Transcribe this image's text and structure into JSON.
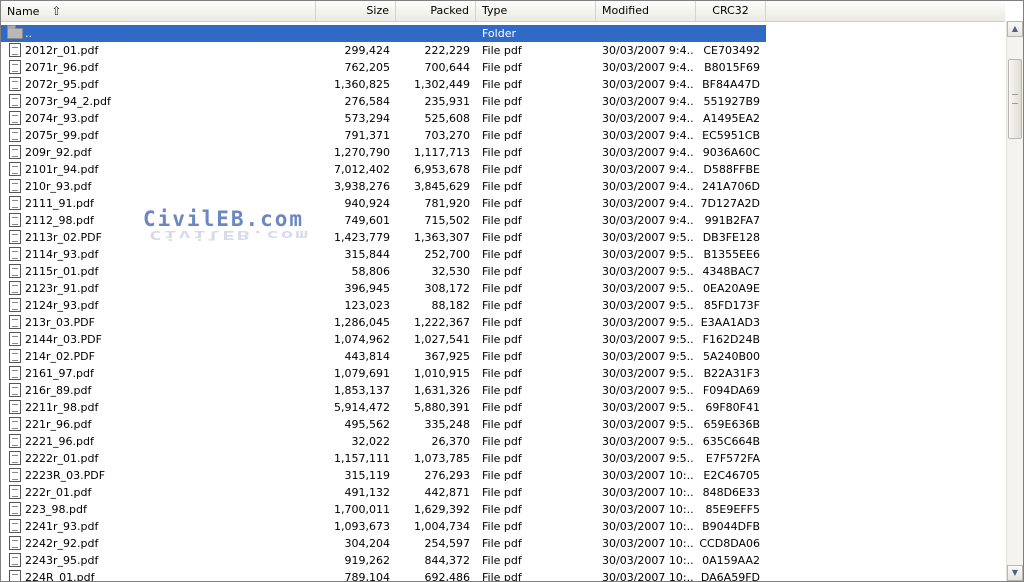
{
  "columns": {
    "name": "Name",
    "size": "Size",
    "packed": "Packed",
    "type": "Type",
    "modified": "Modified",
    "crc": "CRC32"
  },
  "sort_icon": "sort-up-arrow-icon",
  "watermark": "CivilEB.com",
  "parent_row": {
    "name": "..",
    "type": "Folder"
  },
  "files": [
    {
      "name": "2012r_01.pdf",
      "size": "299,424",
      "packed": "222,229",
      "type": "File pdf",
      "modified": "30/03/2007 9:4...",
      "crc": "CE703492"
    },
    {
      "name": "2071r_96.pdf",
      "size": "762,205",
      "packed": "700,644",
      "type": "File pdf",
      "modified": "30/03/2007 9:4...",
      "crc": "B8015F69"
    },
    {
      "name": "2072r_95.pdf",
      "size": "1,360,825",
      "packed": "1,302,449",
      "type": "File pdf",
      "modified": "30/03/2007 9:4...",
      "crc": "BF84A47D"
    },
    {
      "name": "2073r_94_2.pdf",
      "size": "276,584",
      "packed": "235,931",
      "type": "File pdf",
      "modified": "30/03/2007 9:4...",
      "crc": "551927B9"
    },
    {
      "name": "2074r_93.pdf",
      "size": "573,294",
      "packed": "525,608",
      "type": "File pdf",
      "modified": "30/03/2007 9:4...",
      "crc": "A1495EA2"
    },
    {
      "name": "2075r_99.pdf",
      "size": "791,371",
      "packed": "703,270",
      "type": "File pdf",
      "modified": "30/03/2007 9:4...",
      "crc": "EC5951CB"
    },
    {
      "name": "209r_92.pdf",
      "size": "1,270,790",
      "packed": "1,117,713",
      "type": "File pdf",
      "modified": "30/03/2007 9:4...",
      "crc": "9036A60C"
    },
    {
      "name": "2101r_94.pdf",
      "size": "7,012,402",
      "packed": "6,953,678",
      "type": "File pdf",
      "modified": "30/03/2007 9:4...",
      "crc": "D588FFBE"
    },
    {
      "name": "210r_93.pdf",
      "size": "3,938,276",
      "packed": "3,845,629",
      "type": "File pdf",
      "modified": "30/03/2007 9:4...",
      "crc": "241A706D"
    },
    {
      "name": "2111_91.pdf",
      "size": "940,924",
      "packed": "781,920",
      "type": "File pdf",
      "modified": "30/03/2007 9:4...",
      "crc": "7D127A2D"
    },
    {
      "name": "2112_98.pdf",
      "size": "749,601",
      "packed": "715,502",
      "type": "File pdf",
      "modified": "30/03/2007 9:4...",
      "crc": "991B2FA7"
    },
    {
      "name": "2113r_02.PDF",
      "size": "1,423,779",
      "packed": "1,363,307",
      "type": "File pdf",
      "modified": "30/03/2007 9:5...",
      "crc": "DB3FE128"
    },
    {
      "name": "2114r_93.pdf",
      "size": "315,844",
      "packed": "252,700",
      "type": "File pdf",
      "modified": "30/03/2007 9:5...",
      "crc": "B1355EE6"
    },
    {
      "name": "2115r_01.pdf",
      "size": "58,806",
      "packed": "32,530",
      "type": "File pdf",
      "modified": "30/03/2007 9:5...",
      "crc": "4348BAC7"
    },
    {
      "name": "2123r_91.pdf",
      "size": "396,945",
      "packed": "308,172",
      "type": "File pdf",
      "modified": "30/03/2007 9:5...",
      "crc": "0EA20A9E"
    },
    {
      "name": "2124r_93.pdf",
      "size": "123,023",
      "packed": "88,182",
      "type": "File pdf",
      "modified": "30/03/2007 9:5...",
      "crc": "85FD173F"
    },
    {
      "name": "213r_03.PDF",
      "size": "1,286,045",
      "packed": "1,222,367",
      "type": "File pdf",
      "modified": "30/03/2007 9:5...",
      "crc": "E3AA1AD3"
    },
    {
      "name": "2144r_03.PDF",
      "size": "1,074,962",
      "packed": "1,027,541",
      "type": "File pdf",
      "modified": "30/03/2007 9:5...",
      "crc": "F162D24B"
    },
    {
      "name": "214r_02.PDF",
      "size": "443,814",
      "packed": "367,925",
      "type": "File pdf",
      "modified": "30/03/2007 9:5...",
      "crc": "5A240B00"
    },
    {
      "name": "2161_97.pdf",
      "size": "1,079,691",
      "packed": "1,010,915",
      "type": "File pdf",
      "modified": "30/03/2007 9:5...",
      "crc": "B22A31F3"
    },
    {
      "name": "216r_89.pdf",
      "size": "1,853,137",
      "packed": "1,631,326",
      "type": "File pdf",
      "modified": "30/03/2007 9:5...",
      "crc": "F094DA69"
    },
    {
      "name": "2211r_98.pdf",
      "size": "5,914,472",
      "packed": "5,880,391",
      "type": "File pdf",
      "modified": "30/03/2007 9:5...",
      "crc": "69F80F41"
    },
    {
      "name": "221r_96.pdf",
      "size": "495,562",
      "packed": "335,248",
      "type": "File pdf",
      "modified": "30/03/2007 9:5...",
      "crc": "659E636B"
    },
    {
      "name": "2221_96.pdf",
      "size": "32,022",
      "packed": "26,370",
      "type": "File pdf",
      "modified": "30/03/2007 9:5...",
      "crc": "635C664B"
    },
    {
      "name": "2222r_01.pdf",
      "size": "1,157,111",
      "packed": "1,073,785",
      "type": "File pdf",
      "modified": "30/03/2007 9:5...",
      "crc": "E7F572FA"
    },
    {
      "name": "2223R_03.PDF",
      "size": "315,119",
      "packed": "276,293",
      "type": "File pdf",
      "modified": "30/03/2007 10:...",
      "crc": "E2C46705"
    },
    {
      "name": "222r_01.pdf",
      "size": "491,132",
      "packed": "442,871",
      "type": "File pdf",
      "modified": "30/03/2007 10:...",
      "crc": "848D6E33"
    },
    {
      "name": "223_98.pdf",
      "size": "1,700,011",
      "packed": "1,629,392",
      "type": "File pdf",
      "modified": "30/03/2007 10:...",
      "crc": "85E9EFF5"
    },
    {
      "name": "2241r_93.pdf",
      "size": "1,093,673",
      "packed": "1,004,734",
      "type": "File pdf",
      "modified": "30/03/2007 10:...",
      "crc": "B9044DFB"
    },
    {
      "name": "2242r_92.pdf",
      "size": "304,204",
      "packed": "254,597",
      "type": "File pdf",
      "modified": "30/03/2007 10:...",
      "crc": "CCD8DA06"
    },
    {
      "name": "2243r_95.pdf",
      "size": "919,262",
      "packed": "844,372",
      "type": "File pdf",
      "modified": "30/03/2007 10:...",
      "crc": "0A159AA2"
    },
    {
      "name": "224R_01.pdf",
      "size": "789,104",
      "packed": "692,486",
      "type": "File pdf",
      "modified": "30/03/2007 10:...",
      "crc": "DA6A59FD"
    }
  ],
  "icons": {
    "file": "pdf-file-icon",
    "folder": "folder-icon",
    "scroll_up": "scroll-up-arrow-icon",
    "scroll_down": "scroll-down-arrow-icon"
  }
}
